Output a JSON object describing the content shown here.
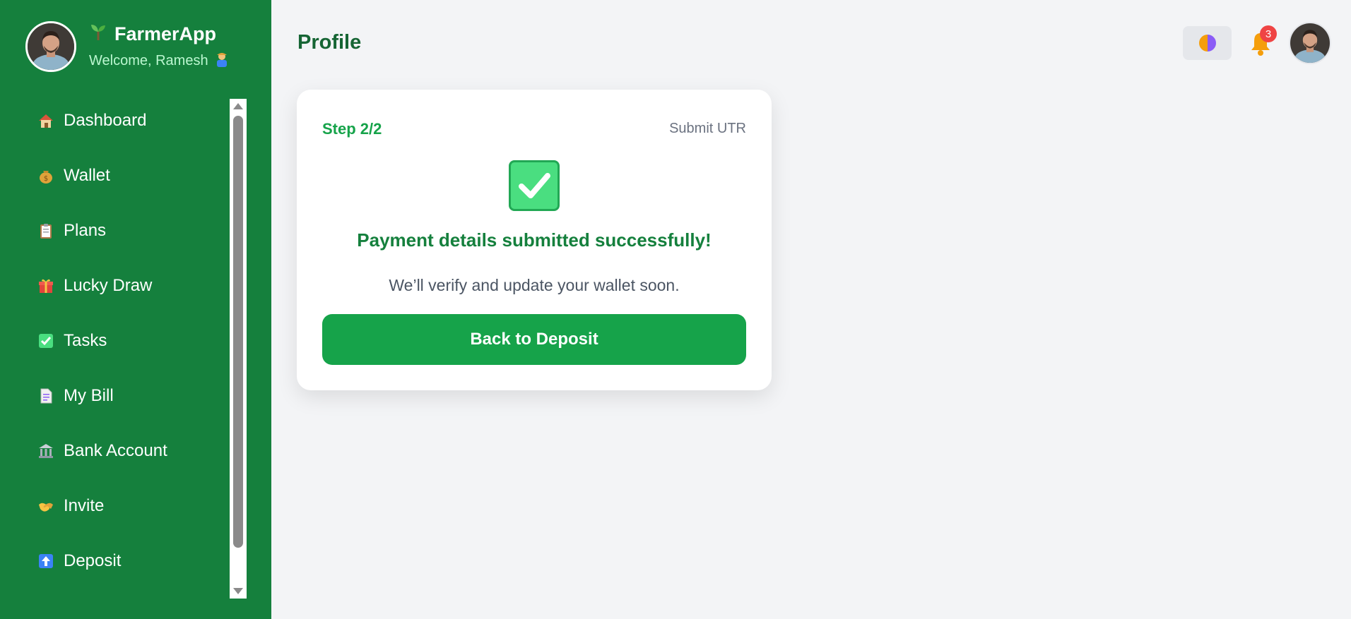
{
  "app": {
    "name": "FarmerApp",
    "brand_icon": "seedling-icon",
    "welcome": "Welcome, Ramesh",
    "welcome_icon": "farmer-emoji-icon"
  },
  "sidebar": {
    "items": [
      {
        "label": "Dashboard",
        "icon": "house-icon"
      },
      {
        "label": "Wallet",
        "icon": "money-bag-icon"
      },
      {
        "label": "Plans",
        "icon": "clipboard-icon"
      },
      {
        "label": "Lucky Draw",
        "icon": "gift-icon"
      },
      {
        "label": "Tasks",
        "icon": "check-box-icon"
      },
      {
        "label": "My Bill",
        "icon": "document-icon"
      },
      {
        "label": "Bank Account",
        "icon": "bank-icon"
      },
      {
        "label": "Invite",
        "icon": "handshake-icon"
      },
      {
        "label": "Deposit",
        "icon": "up-arrow-icon"
      }
    ]
  },
  "header": {
    "title": "Profile",
    "notification_count": "3"
  },
  "card": {
    "step": "Step 2/2",
    "step_name": "Submit UTR",
    "success_title": "Payment details submitted successfully!",
    "success_message": "We’ll verify and update your wallet soon.",
    "button_label": "Back to Deposit"
  },
  "colors": {
    "sidebar_bg": "#15803d",
    "accent": "#16a34a",
    "page_bg": "#f3f4f6",
    "badge": "#ef4444"
  }
}
